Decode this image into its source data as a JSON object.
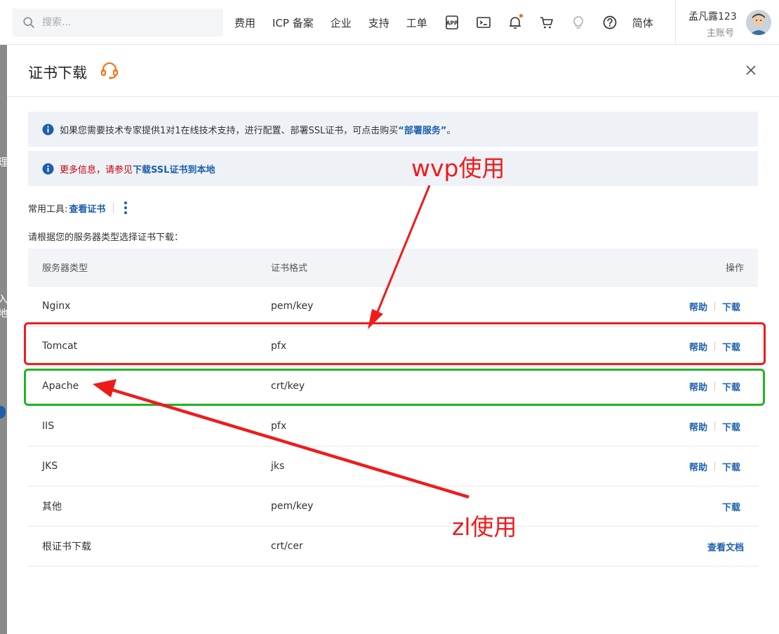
{
  "topbar": {
    "search_placeholder": "搜索...",
    "nav_items": [
      "费用",
      "ICP 备案",
      "企业",
      "支持",
      "工单"
    ],
    "icons": [
      "app-icon",
      "terminal-icon",
      "bell-icon",
      "cart-icon",
      "lightbulb-icon",
      "help-icon"
    ],
    "lang": "简体",
    "account_name": "孟凡露123",
    "account_role": "主账号",
    "accent_color": "#ff6a00"
  },
  "background_page": {
    "fragment1": "理",
    "fragment2": "入地"
  },
  "panel": {
    "title": "证书下载",
    "notice1_text": "如果您需要技术专家提供1对1在线技术支持，进行配置、部署SSL证书，可点击购买",
    "notice1_link": "“部署服务”",
    "notice1_end": "。",
    "notice2_text": "更多信息，请参见",
    "notice2_link": "下载SSL证书到本地",
    "tools_label": "常用工具:",
    "tools_link": "查看证书",
    "hint": "请根据您的服务器类型选择证书下载：",
    "columns": [
      "服务器类型",
      "证书格式",
      "操作"
    ],
    "rows": [
      {
        "server": "Nginx",
        "format": "pem/key",
        "help": "帮助",
        "download": "下载"
      },
      {
        "server": "Tomcat",
        "format": "pfx",
        "help": "帮助",
        "download": "下载"
      },
      {
        "server": "Apache",
        "format": "crt/key",
        "help": "帮助",
        "download": "下载"
      },
      {
        "server": "IIS",
        "format": "pfx",
        "help": "帮助",
        "download": "下载"
      },
      {
        "server": "JKS",
        "format": "jks",
        "help": "帮助",
        "download": "下载"
      },
      {
        "server": "其他",
        "format": "pem/key",
        "download": "下载"
      },
      {
        "server": "根证书下载",
        "format": "crt/cer",
        "doc": "查看文档"
      }
    ],
    "link_color": "#1d5fad"
  },
  "annotations": {
    "label_wvp": "wvp使用",
    "label_zl": "zl使用",
    "red_color": "#ef1b1b",
    "green_color": "#22b328"
  }
}
